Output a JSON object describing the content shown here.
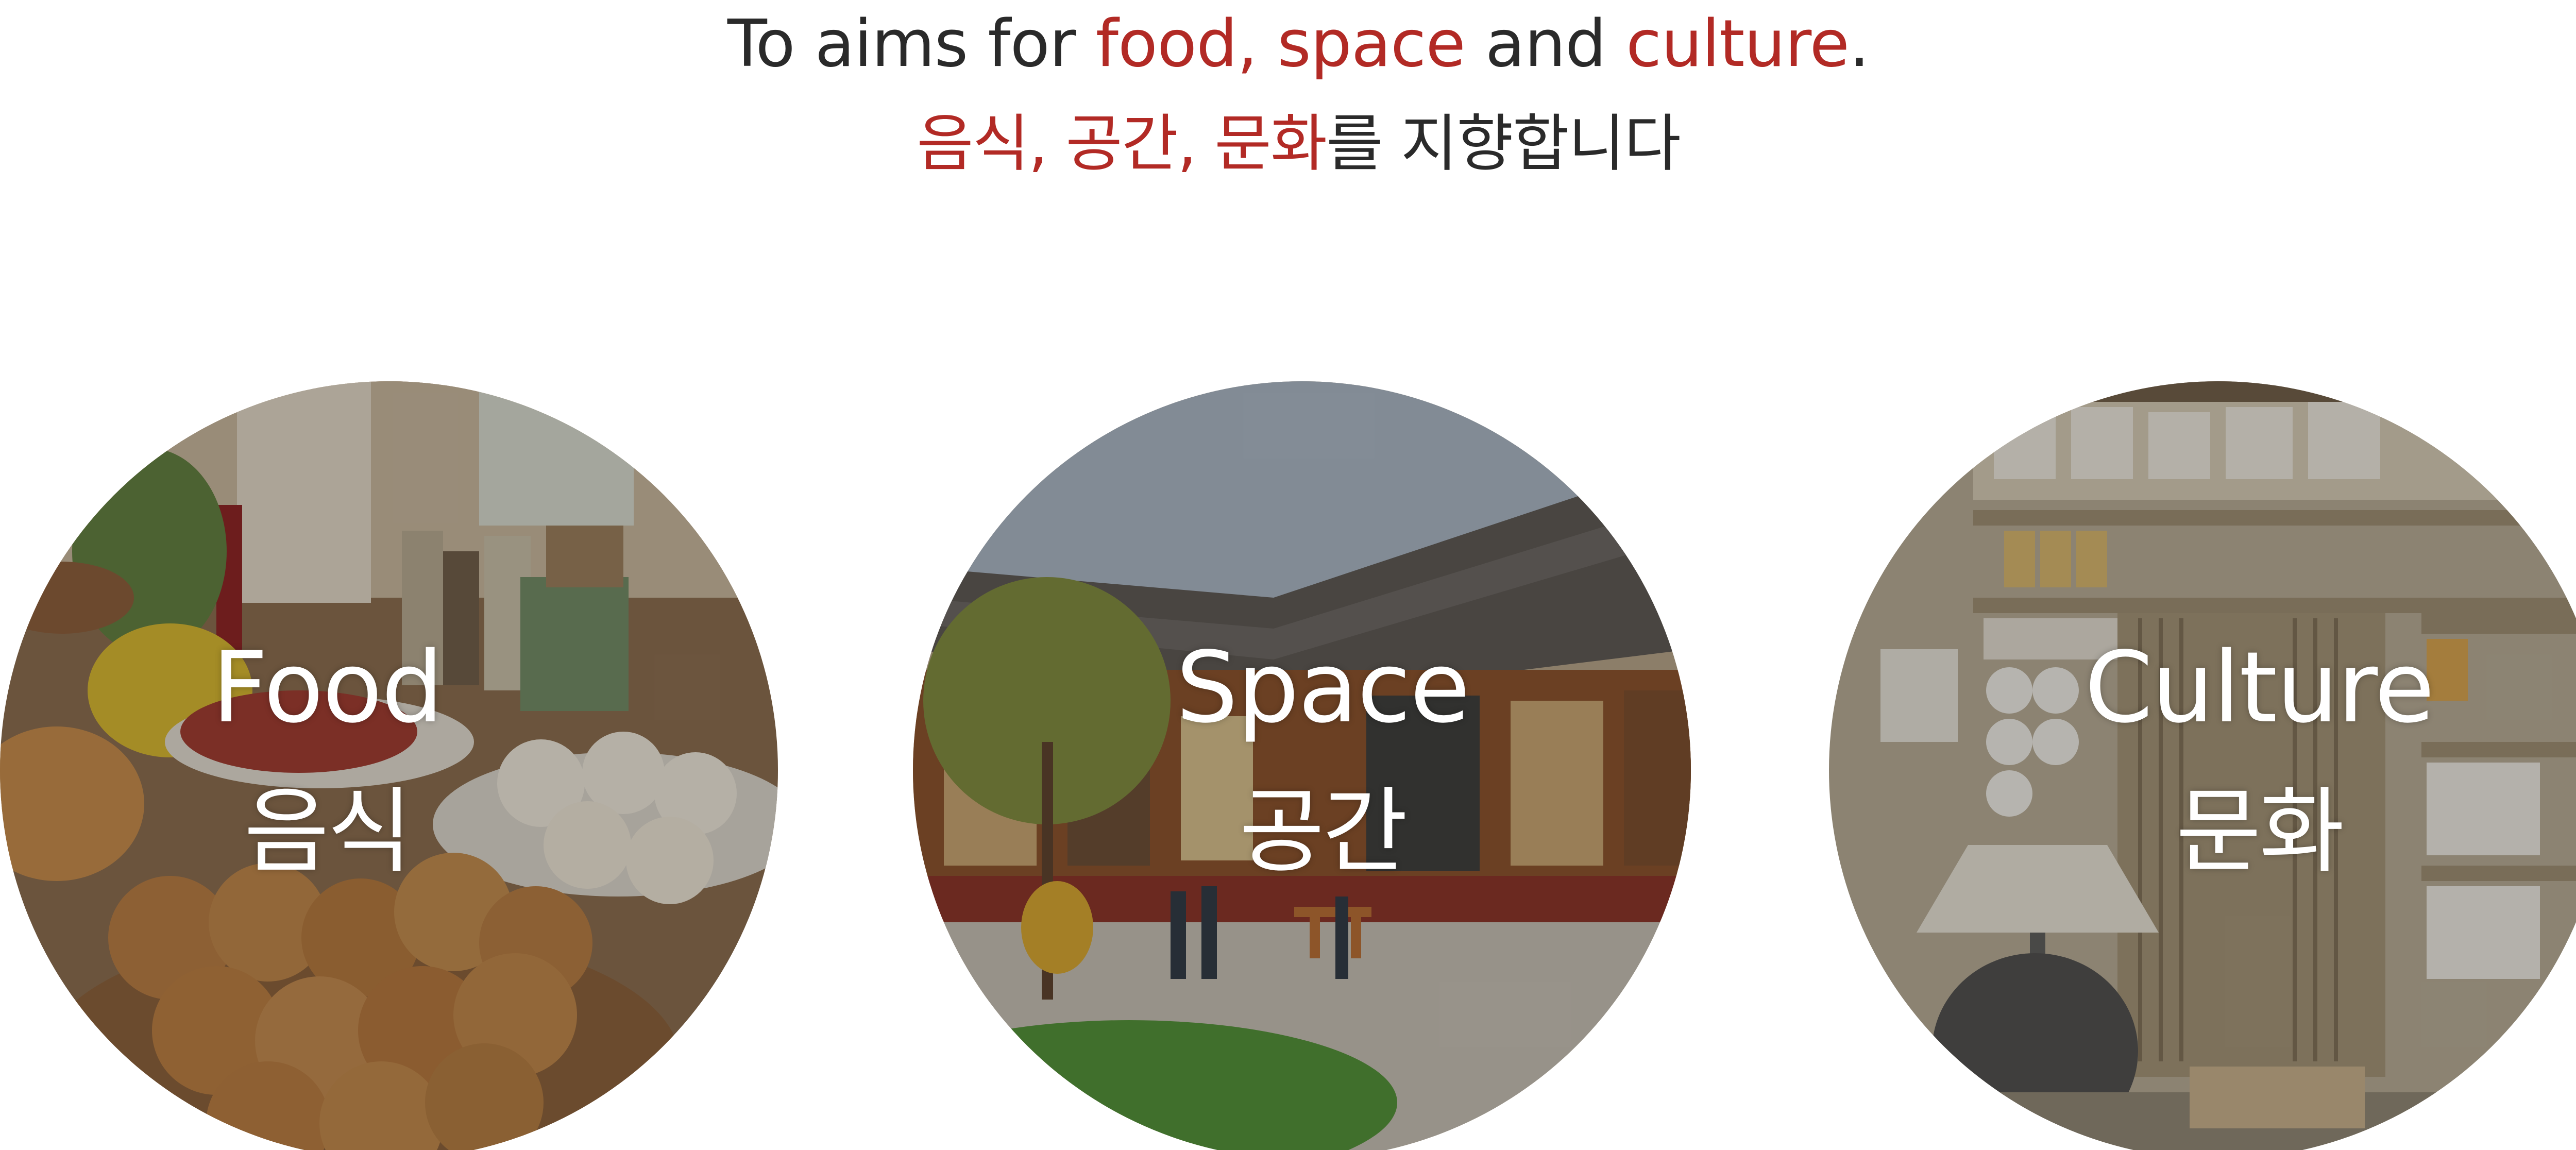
{
  "intro": {
    "en": {
      "prefix": "To aims for ",
      "food": "food,",
      "space": "space",
      "and": "and",
      "culture": "culture",
      "end": "."
    },
    "ko": {
      "food": "음식,",
      "space": "공간,",
      "culture": "문화",
      "suffix": "를 지향합니다"
    }
  },
  "cards": [
    {
      "title_en": "Food",
      "title_ko": "음식"
    },
    {
      "title_en": "Space",
      "title_ko": "공간"
    },
    {
      "title_en": "Culture",
      "title_ko": "문화"
    }
  ],
  "colors": {
    "accent": "#b22a25",
    "text": "#2a2a2a",
    "overlay_text": "#ffffff"
  }
}
